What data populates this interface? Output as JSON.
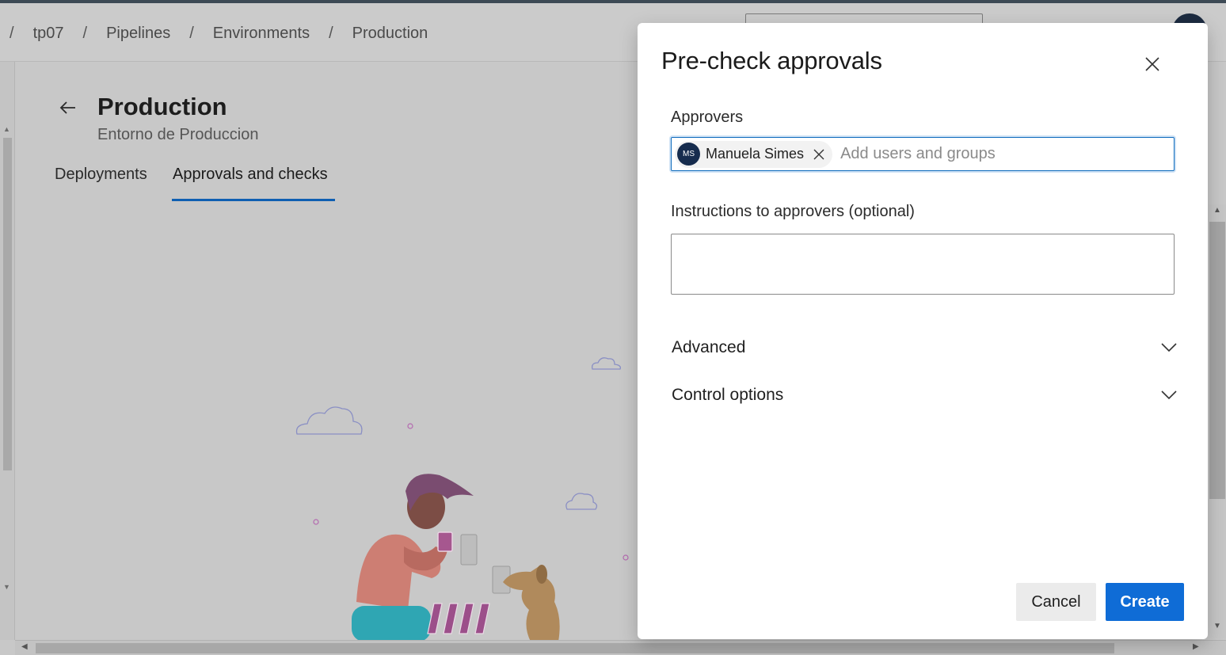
{
  "breadcrumb": {
    "separator": "/",
    "items": [
      "tp07",
      "Pipelines",
      "Environments",
      "Production"
    ]
  },
  "page": {
    "title": "Production",
    "subtitle": "Entorno de Produccion",
    "tabs": [
      {
        "label": "Deployments",
        "selected": false
      },
      {
        "label": "Approvals and checks",
        "selected": true
      }
    ]
  },
  "dialog": {
    "title": "Pre-check approvals",
    "approvers_label": "Approvers",
    "approvers": [
      {
        "initials": "MS",
        "name": "Manuela Simes"
      }
    ],
    "approvers_placeholder": "Add users and groups",
    "instructions_label": "Instructions to approvers (optional)",
    "instructions_value": "",
    "sections": [
      {
        "label": "Advanced",
        "expanded": false
      },
      {
        "label": "Control options",
        "expanded": false
      }
    ],
    "cancel_label": "Cancel",
    "create_label": "Create"
  },
  "colors": {
    "accent": "#0f6cd6",
    "tab_underline": "#0f5fb2",
    "avatar": "#162c4e"
  },
  "icons": {
    "close": "close-icon",
    "back": "arrow-left-icon",
    "chevron": "chevron-down-icon",
    "remove": "remove-icon"
  }
}
